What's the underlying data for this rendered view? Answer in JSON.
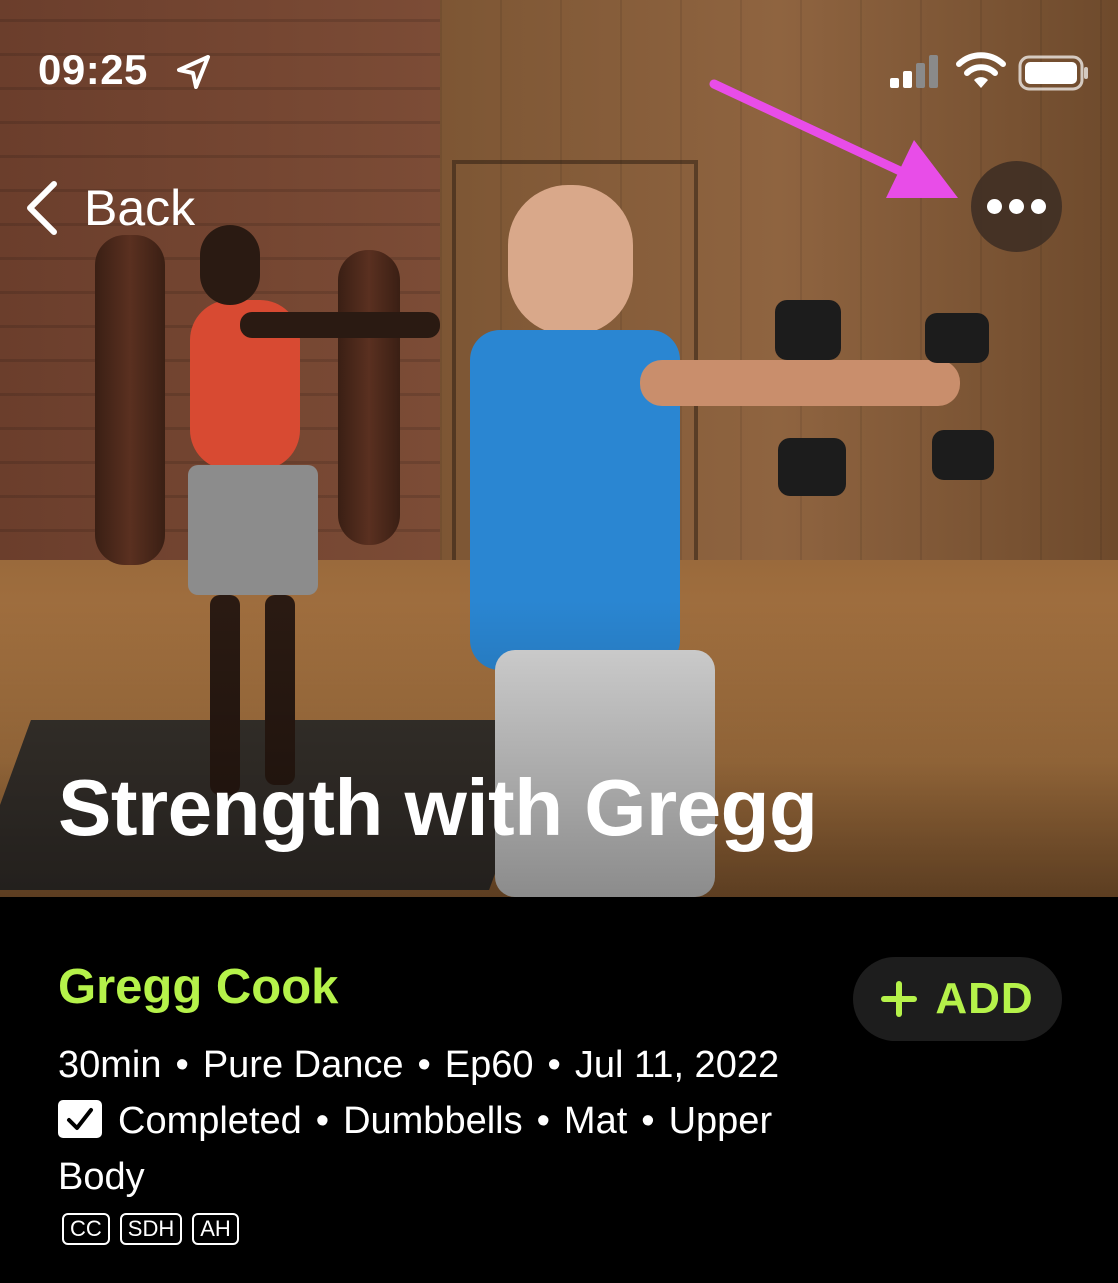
{
  "status_bar": {
    "time": "09:25",
    "icons": [
      "location-arrow-icon",
      "cellular-signal-icon",
      "wifi-icon",
      "battery-icon"
    ]
  },
  "nav": {
    "back_label": "Back",
    "more_icon": "ellipsis-icon"
  },
  "hero": {
    "title": "Strength with Gregg"
  },
  "annotation": {
    "arrow_color": "#e84de8"
  },
  "workout": {
    "trainer": "Gregg Cook",
    "add_label": "ADD",
    "duration": "30min",
    "music": "Pure Dance",
    "episode": "Ep60",
    "date": "Jul 11, 2022",
    "completed_label": "Completed",
    "equipment_1": "Dumbbells",
    "equipment_2": "Mat",
    "focus": "Upper Body",
    "separator": "•",
    "badges": [
      "CC",
      "SDH",
      "AH"
    ]
  },
  "colors": {
    "accent": "#b5f24a",
    "background": "#000000"
  }
}
